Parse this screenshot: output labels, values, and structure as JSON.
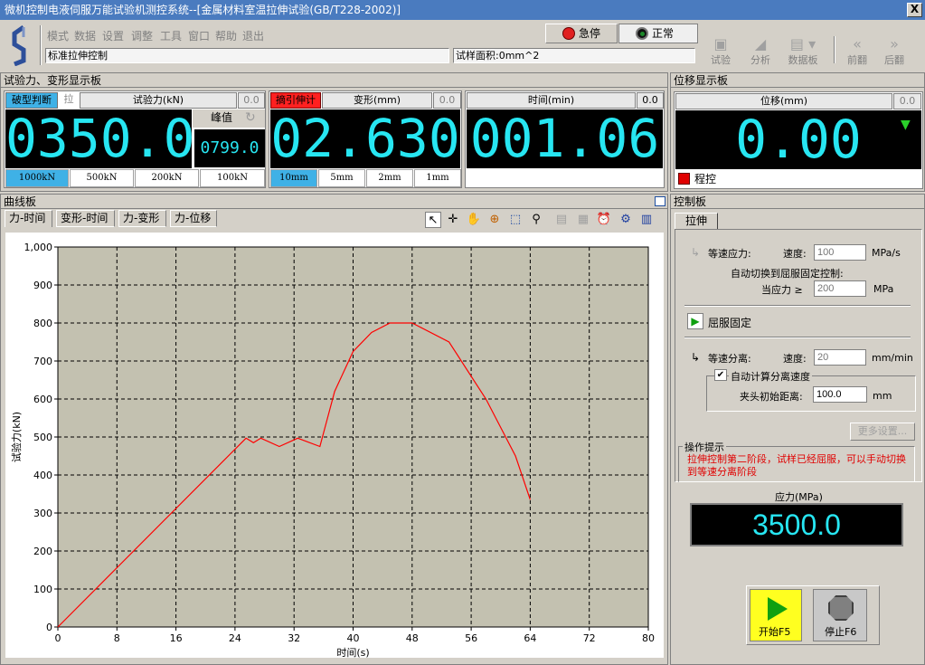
{
  "window": {
    "title": "微机控制电液伺服万能试验机测控系统--[金属材料室温拉伸试验(GB/T228-2002)]",
    "close": "X"
  },
  "menu": [
    "模式",
    "数据",
    "设置",
    "调整",
    "工具",
    "窗口",
    "帮助",
    "退出"
  ],
  "mode_field": "标准拉伸控制",
  "area_field": "试样面积:0mm^2",
  "estop": {
    "label": "急停"
  },
  "status": {
    "label": "正常"
  },
  "toolbar": {
    "test": "试验",
    "analyze": "分析",
    "databoard": "数据板",
    "prev": "前翻",
    "next": "后翻"
  },
  "display_panel": {
    "title": "试验力、变形显示板",
    "force": {
      "break_btn": "破型判断",
      "pull": "拉",
      "header": "试验力(kN)",
      "zero": "0.0",
      "value": "0350.0",
      "peak_label": "峰值",
      "peak_value": "0799.0",
      "ranges": [
        "1000kN",
        "500kN",
        "200kN",
        "100kN"
      ],
      "active_range": 0
    },
    "deform": {
      "ext_btn": "摘引伸计",
      "header": "变形(mm)",
      "zero": "0.0",
      "value": "02.630",
      "ranges": [
        "10mm",
        "5mm",
        "2mm",
        "1mm"
      ],
      "active_range": 0
    },
    "time": {
      "header": "时间(min)",
      "zero": "0.0",
      "value": "001.06"
    }
  },
  "disp_panel": {
    "title": "位移显示板",
    "header": "位移(mm)",
    "zero": "0.0",
    "value": "0.00",
    "prog_label": "程控"
  },
  "curve_panel": {
    "title": "曲线板",
    "tabs": [
      "力-时间",
      "变形-时间",
      "力-变形",
      "力-位移"
    ],
    "active_tab": 0
  },
  "chart_data": {
    "type": "line",
    "xlabel": "时间(s)",
    "ylabel": "试验力(kN)",
    "xlim": [
      0,
      80
    ],
    "ylim": [
      0,
      1000
    ],
    "xticks": [
      0,
      8,
      16,
      24,
      32,
      40,
      48,
      56,
      64,
      72,
      80
    ],
    "yticks": [
      0,
      100,
      200,
      300,
      400,
      500,
      600,
      700,
      800,
      900,
      1000
    ],
    "ytick_labels": [
      "0",
      "100",
      "200",
      "300",
      "400",
      "500",
      "600",
      "700",
      "800",
      "900",
      "1,000"
    ],
    "grid": true,
    "series": [
      {
        "color": "#ff0000",
        "x": [
          0,
          25.5,
          26.5,
          27.5,
          30,
          32.5,
          35.5,
          37.5,
          40,
          42.5,
          45,
          48,
          53,
          58,
          62,
          64
        ],
        "y": [
          0,
          497,
          485,
          497,
          475,
          497,
          475,
          620,
          725,
          775,
          800,
          800,
          750,
          600,
          450,
          335
        ]
      }
    ]
  },
  "control_panel": {
    "title": "控制板",
    "tab": "拉伸",
    "const_stress": {
      "label": "等速应力:",
      "speed_label": "速度:",
      "speed_placeholder": "100",
      "unit": "MPa/s"
    },
    "auto_switch": {
      "label": "自动切换到屈服固定控制:",
      "cond_label": "当应力 ≥",
      "cond_placeholder": "200",
      "unit": "MPa"
    },
    "yield_fixed": "屈服固定",
    "const_sep": {
      "label": "等速分离:",
      "speed_label": "速度:",
      "speed_placeholder": "20",
      "unit": "mm/min"
    },
    "auto_calc": {
      "label": "自动计算分离速度",
      "checked": true
    },
    "grip_dist": {
      "label": "夹头初始距离:",
      "value": "100.0",
      "unit": "mm"
    },
    "more_btn": "更多设置..."
  },
  "hint": {
    "title": "操作提示",
    "text": "拉伸控制第二阶段，试样已经屈服，可以手动切换到等速分离阶段"
  },
  "stress": {
    "label": "应力(MPa)",
    "value": "3500.0"
  },
  "actions": {
    "start": "开始F5",
    "stop": "停止F6"
  }
}
